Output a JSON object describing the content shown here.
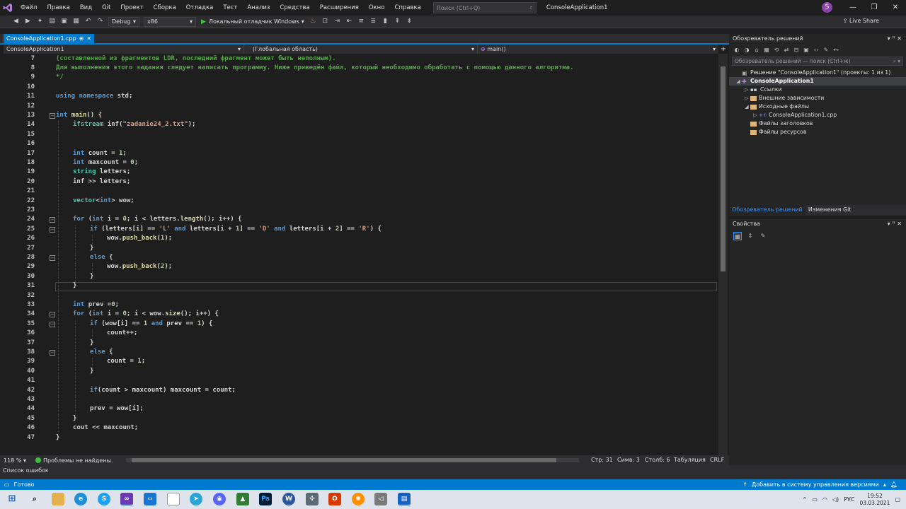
{
  "menu": {
    "items": [
      "Файл",
      "Правка",
      "Вид",
      "Git",
      "Проект",
      "Сборка",
      "Отладка",
      "Тест",
      "Анализ",
      "Средства",
      "Расширения",
      "Окно",
      "Справка"
    ],
    "search_placeholder": "Поиск (Ctrl+Q)",
    "solution_title": "ConsoleApplication1",
    "account_initial": "S"
  },
  "toolbar": {
    "configuration": "Debug",
    "platform": "x86",
    "start_label": "Локальный отладчик Windows",
    "live_share": "Live Share"
  },
  "editor": {
    "tab_label": "ConsoleApplication1.cpp",
    "tab_pin": "⊕",
    "tab_close": "✕",
    "nav_project": "ConsoleApplication1",
    "nav_scope": "(Глобальная область)",
    "nav_member": "main()",
    "lines": [
      {
        "n": "7",
        "indent": 0,
        "fold": "",
        "segs": [
          [
            "(составленной из фрагментов LDR, последний фрагмент может быть неполным).",
            "cm"
          ]
        ]
      },
      {
        "n": "8",
        "indent": 0,
        "fold": "",
        "segs": [
          [
            "Для выполнения этого задания следует написать программу. Ниже приведён файл, который необходимо обработать с помощью данного алгоритма.",
            "cm"
          ]
        ]
      },
      {
        "n": "9",
        "indent": 0,
        "fold": "",
        "segs": [
          [
            "*/",
            "cm"
          ]
        ]
      },
      {
        "n": "10",
        "indent": 0,
        "fold": "",
        "segs": []
      },
      {
        "n": "11",
        "indent": 0,
        "fold": "",
        "segs": [
          [
            "using ",
            "kw"
          ],
          [
            "namespace ",
            "kw"
          ],
          [
            "std",
            "pl"
          ],
          [
            ";",
            "pl"
          ]
        ]
      },
      {
        "n": "12",
        "indent": 0,
        "fold": "",
        "segs": []
      },
      {
        "n": "13",
        "indent": 0,
        "fold": "-",
        "segs": [
          [
            "int ",
            "kw"
          ],
          [
            "main",
            "fn"
          ],
          [
            "() {",
            "pl"
          ]
        ]
      },
      {
        "n": "14",
        "indent": 1,
        "fold": "",
        "segs": [
          [
            "ifstream ",
            "ty"
          ],
          [
            "inf(",
            "pl"
          ],
          [
            "\"zadanie24_2.txt\"",
            "st"
          ],
          [
            ");",
            "pl"
          ]
        ]
      },
      {
        "n": "15",
        "indent": 1,
        "fold": "",
        "segs": []
      },
      {
        "n": "16",
        "indent": 1,
        "fold": "",
        "segs": []
      },
      {
        "n": "17",
        "indent": 1,
        "fold": "",
        "segs": [
          [
            "int ",
            "kw"
          ],
          [
            "count = ",
            "pl"
          ],
          [
            "1",
            "nm"
          ],
          [
            ";",
            "pl"
          ]
        ]
      },
      {
        "n": "18",
        "indent": 1,
        "fold": "",
        "segs": [
          [
            "int ",
            "kw"
          ],
          [
            "maxcount = ",
            "pl"
          ],
          [
            "0",
            "nm"
          ],
          [
            ";",
            "pl"
          ]
        ]
      },
      {
        "n": "19",
        "indent": 1,
        "fold": "",
        "segs": [
          [
            "string ",
            "ty"
          ],
          [
            "letters;",
            "pl"
          ]
        ]
      },
      {
        "n": "20",
        "indent": 1,
        "fold": "",
        "segs": [
          [
            "inf >> letters;",
            "pl"
          ]
        ]
      },
      {
        "n": "21",
        "indent": 1,
        "fold": "",
        "segs": []
      },
      {
        "n": "22",
        "indent": 1,
        "fold": "",
        "segs": [
          [
            "vector",
            "ty"
          ],
          [
            "<",
            "pl"
          ],
          [
            "int",
            "kw"
          ],
          [
            "> wow;",
            "pl"
          ]
        ]
      },
      {
        "n": "23",
        "indent": 1,
        "fold": "",
        "segs": []
      },
      {
        "n": "24",
        "indent": 1,
        "fold": "-",
        "segs": [
          [
            "for ",
            "kw"
          ],
          [
            "(",
            "pl"
          ],
          [
            "int ",
            "kw"
          ],
          [
            "i = ",
            "pl"
          ],
          [
            "0",
            "nm"
          ],
          [
            "; i < letters.",
            "pl"
          ],
          [
            "length",
            "fn"
          ],
          [
            "(); i++) {",
            "pl"
          ]
        ]
      },
      {
        "n": "25",
        "indent": 2,
        "fold": "-",
        "segs": [
          [
            "if ",
            "kw"
          ],
          [
            "(letters[i] == ",
            "pl"
          ],
          [
            "'L'",
            "st"
          ],
          [
            " and ",
            "kw"
          ],
          [
            "letters[i + ",
            "pl"
          ],
          [
            "1",
            "nm"
          ],
          [
            "] == ",
            "pl"
          ],
          [
            "'D'",
            "st"
          ],
          [
            " and ",
            "kw"
          ],
          [
            "letters[i + ",
            "pl"
          ],
          [
            "2",
            "nm"
          ],
          [
            "] == ",
            "pl"
          ],
          [
            "'R'",
            "st"
          ],
          [
            ") {",
            "pl"
          ]
        ]
      },
      {
        "n": "26",
        "indent": 3,
        "fold": "",
        "segs": [
          [
            "wow.",
            "pl"
          ],
          [
            "push_back",
            "fn"
          ],
          [
            "(",
            "pl"
          ],
          [
            "1",
            "nm"
          ],
          [
            ");",
            "pl"
          ]
        ]
      },
      {
        "n": "27",
        "indent": 2,
        "fold": "",
        "segs": [
          [
            "}",
            "pl"
          ]
        ]
      },
      {
        "n": "28",
        "indent": 2,
        "fold": "-",
        "segs": [
          [
            "else ",
            "kw"
          ],
          [
            "{",
            "pl"
          ]
        ]
      },
      {
        "n": "29",
        "indent": 3,
        "fold": "",
        "segs": [
          [
            "wow.",
            "pl"
          ],
          [
            "push_back",
            "fn"
          ],
          [
            "(",
            "pl"
          ],
          [
            "2",
            "nm"
          ],
          [
            ");",
            "pl"
          ]
        ]
      },
      {
        "n": "30",
        "indent": 2,
        "fold": "",
        "segs": [
          [
            "}",
            "pl"
          ]
        ]
      },
      {
        "n": "31",
        "indent": 1,
        "fold": "",
        "segs": [
          [
            "}",
            "pl"
          ]
        ]
      },
      {
        "n": "32",
        "indent": 1,
        "fold": "",
        "segs": []
      },
      {
        "n": "33",
        "indent": 1,
        "fold": "",
        "segs": [
          [
            "int ",
            "kw"
          ],
          [
            "prev =",
            "pl"
          ],
          [
            "0",
            "nm"
          ],
          [
            ";",
            "pl"
          ]
        ]
      },
      {
        "n": "34",
        "indent": 1,
        "fold": "-",
        "segs": [
          [
            "for ",
            "kw"
          ],
          [
            "(",
            "pl"
          ],
          [
            "int ",
            "kw"
          ],
          [
            "i = ",
            "pl"
          ],
          [
            "0",
            "nm"
          ],
          [
            "; i < wow.",
            "pl"
          ],
          [
            "size",
            "fn"
          ],
          [
            "(); i++) {",
            "pl"
          ]
        ]
      },
      {
        "n": "35",
        "indent": 2,
        "fold": "-",
        "segs": [
          [
            "if ",
            "kw"
          ],
          [
            "(wow[i] == ",
            "pl"
          ],
          [
            "1",
            "nm"
          ],
          [
            " and ",
            "kw"
          ],
          [
            "prev == ",
            "pl"
          ],
          [
            "1",
            "nm"
          ],
          [
            ") {",
            "pl"
          ]
        ]
      },
      {
        "n": "36",
        "indent": 3,
        "fold": "",
        "segs": [
          [
            "count++;",
            "pl"
          ]
        ]
      },
      {
        "n": "37",
        "indent": 2,
        "fold": "",
        "segs": [
          [
            "}",
            "pl"
          ]
        ]
      },
      {
        "n": "38",
        "indent": 2,
        "fold": "-",
        "segs": [
          [
            "else ",
            "kw"
          ],
          [
            "{",
            "pl"
          ]
        ]
      },
      {
        "n": "39",
        "indent": 3,
        "fold": "",
        "segs": [
          [
            "count = ",
            "pl"
          ],
          [
            "1",
            "nm"
          ],
          [
            ";",
            "pl"
          ]
        ]
      },
      {
        "n": "40",
        "indent": 2,
        "fold": "",
        "segs": [
          [
            "}",
            "pl"
          ]
        ]
      },
      {
        "n": "41",
        "indent": 2,
        "fold": "",
        "segs": []
      },
      {
        "n": "42",
        "indent": 2,
        "fold": "",
        "segs": [
          [
            "if",
            "kw"
          ],
          [
            "(count > maxcount) maxcount = count;",
            "pl"
          ]
        ]
      },
      {
        "n": "43",
        "indent": 2,
        "fold": "",
        "segs": []
      },
      {
        "n": "44",
        "indent": 2,
        "fold": "",
        "segs": [
          [
            "prev = wow[i];",
            "pl"
          ]
        ]
      },
      {
        "n": "45",
        "indent": 1,
        "fold": "",
        "segs": [
          [
            "}",
            "pl"
          ]
        ]
      },
      {
        "n": "46",
        "indent": 1,
        "fold": "",
        "segs": [
          [
            "cout ",
            "pl"
          ],
          [
            "<< ",
            "pl"
          ],
          [
            "maxcount;",
            "pl"
          ]
        ]
      },
      {
        "n": "47",
        "indent": 0,
        "fold": "",
        "segs": [
          [
            "}",
            "pl"
          ]
        ]
      }
    ],
    "current_line": "31",
    "zoom": "118 %",
    "issues": "Проблемы не найдены.",
    "line_pos": "Стр: 31",
    "char_pos": "Симв: 3",
    "col_pos": "Столб: 6",
    "tab_mode": "Табуляция",
    "eol": "CRLF"
  },
  "solution_explorer": {
    "title": "Обозреватель решений",
    "search_placeholder": "Обозреватель решений — поиск (Ctrl+ж)",
    "tree": [
      {
        "label": "Решение \"ConsoleApplication1\" (проекты: 1 из 1)",
        "depth": 0,
        "arrow": "",
        "icon": "solution"
      },
      {
        "label": "ConsoleApplication1",
        "depth": 0,
        "arrow": "◢",
        "icon": "project",
        "selected": true
      },
      {
        "label": "Ссылки",
        "depth": 1,
        "arrow": "▷",
        "icon": "refs"
      },
      {
        "label": "Внешние зависимости",
        "depth": 1,
        "arrow": "▷",
        "icon": "folder"
      },
      {
        "label": "Исходные файлы",
        "depth": 1,
        "arrow": "◢",
        "icon": "folder"
      },
      {
        "label": "ConsoleApplication1.cpp",
        "depth": 2,
        "arrow": "▷",
        "icon": "cpp"
      },
      {
        "label": "Файлы заголовков",
        "depth": 1,
        "arrow": "",
        "icon": "folder"
      },
      {
        "label": "Файлы ресурсов",
        "depth": 1,
        "arrow": "",
        "icon": "folder"
      }
    ],
    "tab_solution": "Обозреватель решений",
    "tab_git": "Изменения Git"
  },
  "properties": {
    "title": "Свойства"
  },
  "bottom": {
    "error_list": "Список ошибок",
    "status": "Готово",
    "source_control": "Добавить в систему управления версиями"
  },
  "taskbar": {
    "lang": "РУС",
    "time": "19:52",
    "date": "03.03.2021"
  }
}
